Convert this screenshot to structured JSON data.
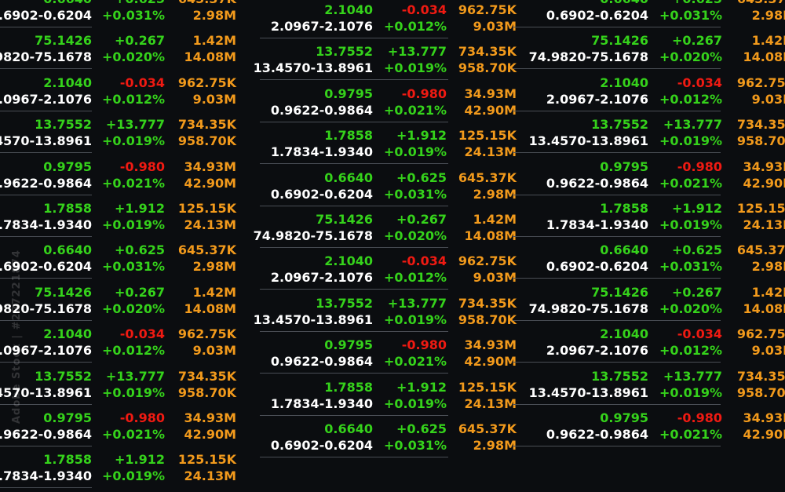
{
  "colors": {
    "background": "#0b0d10",
    "price": "#35d21b",
    "range": "#ffffff",
    "change_positive": "#35d21b",
    "change_negative": "#f01a12",
    "volume": "#f29a1c",
    "separator": "#4a4e55"
  },
  "watermark": "Adobe Stock | #287221874",
  "quotes": [
    {
      "price": "0.6640",
      "range": "0.6902-0.6204",
      "change": "+0.625",
      "pct": "+0.031%",
      "vol1": "645.37K",
      "vol2": "2.98M"
    },
    {
      "price": "75.1426",
      "range": "74.9820-75.1678",
      "change": "+0.267",
      "pct": "+0.020%",
      "vol1": "1.42M",
      "vol2": "14.08M"
    },
    {
      "price": "2.1040",
      "range": "2.0967-2.1076",
      "change": "-0.034",
      "pct": "+0.012%",
      "vol1": "962.75K",
      "vol2": "9.03M"
    },
    {
      "price": "13.7552",
      "range": "13.4570-13.8961",
      "change": "+13.777",
      "pct": "+0.019%",
      "vol1": "734.35K",
      "vol2": "958.70K"
    },
    {
      "price": "0.9795",
      "range": "0.9622-0.9864",
      "change": "-0.980",
      "pct": "+0.021%",
      "vol1": "34.93M",
      "vol2": "42.90M"
    },
    {
      "price": "1.7858",
      "range": "1.7834-1.9340",
      "change": "+1.912",
      "pct": "+0.019%",
      "vol1": "125.15K",
      "vol2": "24.13M"
    }
  ],
  "columns": [
    {
      "start": 0,
      "count": 12
    },
    {
      "start": 2,
      "count": 11
    },
    {
      "start": 0,
      "count": 11
    }
  ]
}
